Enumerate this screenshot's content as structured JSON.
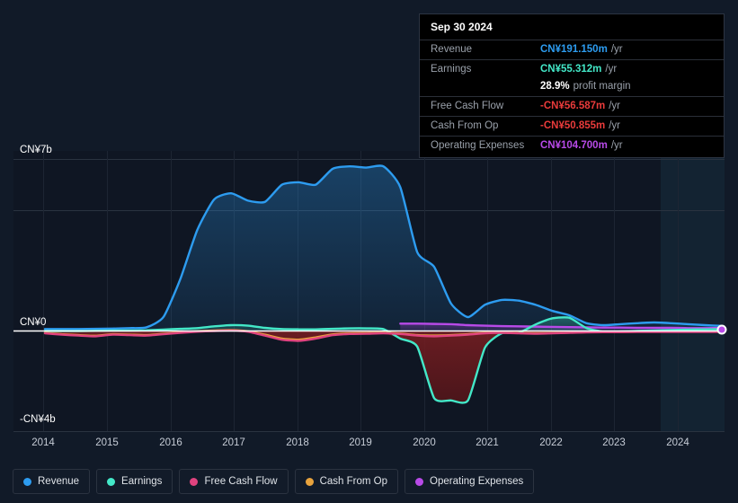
{
  "tooltip": {
    "date": "Sep 30 2024",
    "rows": [
      {
        "label": "Revenue",
        "value": "CN¥191.150m",
        "unit": "/yr",
        "color": "#2d9cf0"
      },
      {
        "label": "Earnings",
        "value": "CN¥55.312m",
        "unit": "/yr",
        "color": "#43e8c8"
      },
      {
        "label": "",
        "value": "28.9%",
        "unit": "profit margin",
        "color": "#ffffff",
        "sub": true
      },
      {
        "label": "Free Cash Flow",
        "value": "-CN¥56.587m",
        "unit": "/yr",
        "color": "#ea3b3b"
      },
      {
        "label": "Cash From Op",
        "value": "-CN¥50.855m",
        "unit": "/yr",
        "color": "#ea3b3b"
      },
      {
        "label": "Operating Expenses",
        "value": "CN¥104.700m",
        "unit": "/yr",
        "color": "#b84ae8"
      }
    ]
  },
  "legend": {
    "items": [
      {
        "label": "Revenue",
        "color": "#2d9cf0"
      },
      {
        "label": "Earnings",
        "color": "#43e8c8"
      },
      {
        "label": "Free Cash Flow",
        "color": "#e0437f"
      },
      {
        "label": "Cash From Op",
        "color": "#e8a33d"
      },
      {
        "label": "Operating Expenses",
        "color": "#b84ae8"
      }
    ]
  },
  "axis": {
    "y_top_label": "CN¥7b",
    "y_zero_label": "CN¥0",
    "y_bottom_label": "-CN¥4b",
    "x_ticks": [
      "2014",
      "2015",
      "2016",
      "2017",
      "2018",
      "2019",
      "2020",
      "2021",
      "2022",
      "2023",
      "2024"
    ]
  },
  "chart_data": {
    "type": "line",
    "title": "",
    "xlabel": "",
    "ylabel": "CN¥",
    "ylim": [
      -4000000000,
      7000000000
    ],
    "ytick_labels": [
      "CN¥7b",
      "CN¥0",
      "-CN¥4b"
    ],
    "ytick_values": [
      7000000000,
      0,
      -4000000000
    ],
    "grid": true,
    "legend_position": "bottom",
    "currency": "CN¥",
    "x": [
      "2014.4",
      "2014.7",
      "2015.0",
      "2015.3",
      "2015.6",
      "2015.9",
      "2016.2",
      "2016.5",
      "2016.8",
      "2017.0",
      "2017.25",
      "2017.5",
      "2017.75",
      "2018.0",
      "2018.25",
      "2018.5",
      "2018.75",
      "2019.0",
      "2019.25",
      "2019.5",
      "2019.75",
      "2020.0",
      "2020.25",
      "2020.5",
      "2020.75",
      "2021.0",
      "2021.25",
      "2021.5",
      "2021.75",
      "2022.0",
      "2022.25",
      "2022.5",
      "2022.75",
      "2023.0",
      "2023.25",
      "2023.5",
      "2023.75",
      "2024.0",
      "2024.25",
      "2024.5",
      "2024.75"
    ],
    "series": [
      {
        "name": "Revenue",
        "color": "#2d9cf0",
        "filled": true,
        "values": [
          60000000.0,
          60000000.0,
          60000000.0,
          70000000.0,
          80000000.0,
          100000000.0,
          130000000.0,
          550000000.0,
          2100000000.0,
          4100000000.0,
          5350000000.0,
          5600000000.0,
          5300000000.0,
          5250000000.0,
          5950000000.0,
          6050000000.0,
          5950000000.0,
          6600000000.0,
          6700000000.0,
          6650000000.0,
          6700000000.0,
          5850000000.0,
          3200000000.0,
          2600000000.0,
          1100000000.0,
          550000000.0,
          1050000000.0,
          1250000000.0,
          1220000000.0,
          1050000000.0,
          800000000.0,
          620000000.0,
          300000000.0,
          220000000.0,
          260000000.0,
          300000000.0,
          330000000.0,
          300000000.0,
          260000000.0,
          220000000.0,
          191150000.0
        ]
      },
      {
        "name": "Earnings",
        "color": "#43e8c8",
        "filled": true,
        "values": [
          -20000000.0,
          -20000000.0,
          -20000000.0,
          -10000000.0,
          0.0,
          0.0,
          10000000.0,
          40000000.0,
          70000000.0,
          100000000.0,
          170000000.0,
          220000000.0,
          200000000.0,
          110000000.0,
          60000000.0,
          50000000.0,
          50000000.0,
          70000000.0,
          90000000.0,
          90000000.0,
          60000000.0,
          -350000000.0,
          -700000000.0,
          -2950000000.0,
          -3050000000.0,
          -3050000000.0,
          -750000000.0,
          -120000000.0,
          -100000000.0,
          250000000.0,
          500000000.0,
          520000000.0,
          100000000.0,
          -50000000.0,
          -40000000.0,
          -20000000.0,
          0.0,
          20000000.0,
          40000000.0,
          50000000.0,
          55312000.0
        ]
      },
      {
        "name": "Free Cash Flow",
        "color": "#e0437f",
        "filled": false,
        "values": [
          -120000000.0,
          -180000000.0,
          -220000000.0,
          -250000000.0,
          -180000000.0,
          -200000000.0,
          -220000000.0,
          -160000000.0,
          -100000000.0,
          -50000000.0,
          -20000000.0,
          0.0,
          -50000000.0,
          -220000000.0,
          -400000000.0,
          -450000000.0,
          -350000000.0,
          -200000000.0,
          -150000000.0,
          -140000000.0,
          -120000000.0,
          -150000000.0,
          -220000000.0,
          -250000000.0,
          -220000000.0,
          -180000000.0,
          -120000000.0,
          -100000000.0,
          -120000000.0,
          -140000000.0,
          -120000000.0,
          -100000000.0,
          -80000000.0,
          -70000000.0,
          -70000000.0,
          -60000000.0,
          -60000000.0,
          -60000000.0,
          -60000000.0,
          -60000000.0,
          -56587000.0
        ]
      },
      {
        "name": "Cash From Op",
        "color": "#e8a33d",
        "filled": false,
        "values": [
          -100000000.0,
          -160000000.0,
          -200000000.0,
          -230000000.0,
          -160000000.0,
          -180000000.0,
          -200000000.0,
          -140000000.0,
          -80000000.0,
          -30000000.0,
          0.0,
          20000000.0,
          -30000000.0,
          -180000000.0,
          -350000000.0,
          -400000000.0,
          -300000000.0,
          -170000000.0,
          -120000000.0,
          -110000000.0,
          -100000000.0,
          -130000000.0,
          -200000000.0,
          -220000000.0,
          -200000000.0,
          -160000000.0,
          -100000000.0,
          -90000000.0,
          -110000000.0,
          -120000000.0,
          -110000000.0,
          -90000000.0,
          -70000000.0,
          -60000000.0,
          -60000000.0,
          -50000000.0,
          -50000000.0,
          -50000000.0,
          -50000000.0,
          -50000000.0,
          -50855000.0
        ]
      },
      {
        "name": "Operating Expenses",
        "color": "#b84ae8",
        "filled": true,
        "values": [
          null,
          null,
          null,
          null,
          null,
          null,
          null,
          null,
          null,
          null,
          null,
          null,
          null,
          null,
          null,
          null,
          null,
          null,
          null,
          null,
          null,
          280000000.0,
          280000000.0,
          270000000.0,
          260000000.0,
          220000000.0,
          200000000.0,
          180000000.0,
          170000000.0,
          160000000.0,
          150000000.0,
          140000000.0,
          130000000.0,
          120000000.0,
          120000000.0,
          110000000.0,
          110000000.0,
          110000000.0,
          100000000.0,
          100000000.0,
          104700000.0
        ]
      }
    ]
  }
}
